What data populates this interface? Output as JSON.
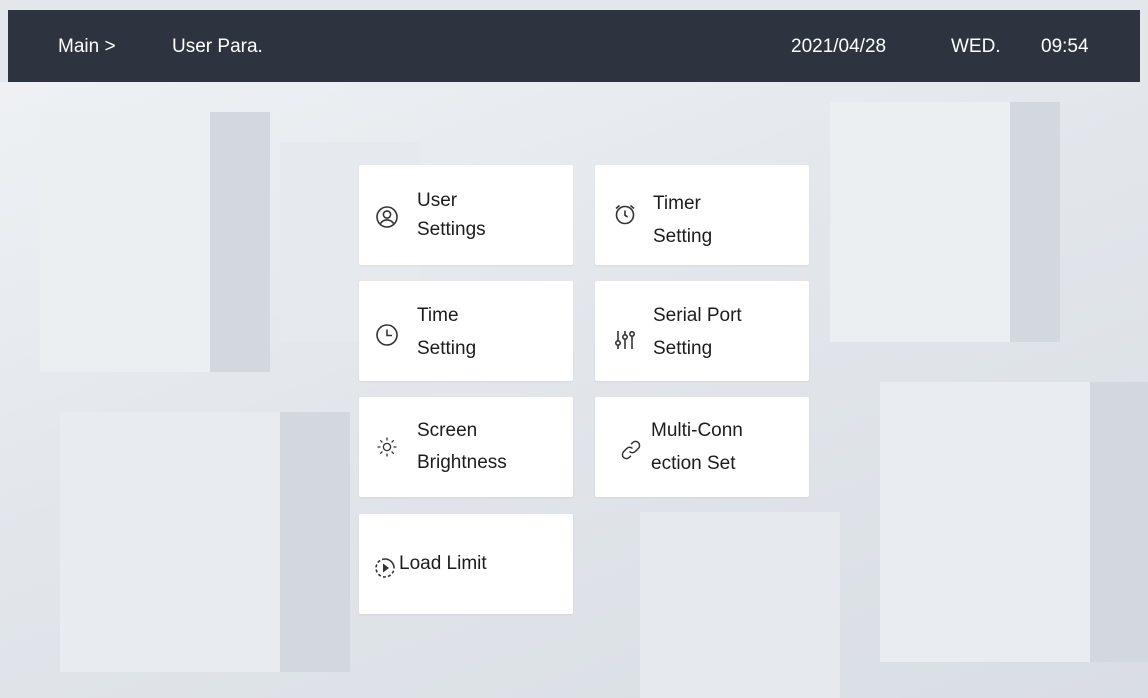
{
  "header": {
    "breadcrumb_root": "Main >",
    "breadcrumb_current": "User Para.",
    "date": "2021/04/28",
    "weekday": "WED.",
    "time": "09:54"
  },
  "menu": {
    "user_settings": {
      "line1": "User",
      "line2": "Settings",
      "icon": "user-icon"
    },
    "timer_setting": {
      "line1": "Timer",
      "line2": "Setting",
      "icon": "alarm-clock-icon"
    },
    "time_setting": {
      "line1": "Time",
      "line2": "Setting",
      "icon": "clock-icon"
    },
    "serial_port_setting": {
      "line1": "Serial Port",
      "line2": "Setting",
      "icon": "sliders-icon"
    },
    "screen_brightness": {
      "line1": "Screen",
      "line2": "Brightness",
      "icon": "sun-icon"
    },
    "multi_connection_set": {
      "line1": "Multi-Conn",
      "line2": "ection Set",
      "icon": "link-icon"
    },
    "load_limit": {
      "line1": "Load Limit",
      "icon": "load-limit-icon"
    }
  },
  "colors": {
    "header_bg": "#2d3440",
    "tile_bg": "#ffffff",
    "icon": "#333333"
  }
}
